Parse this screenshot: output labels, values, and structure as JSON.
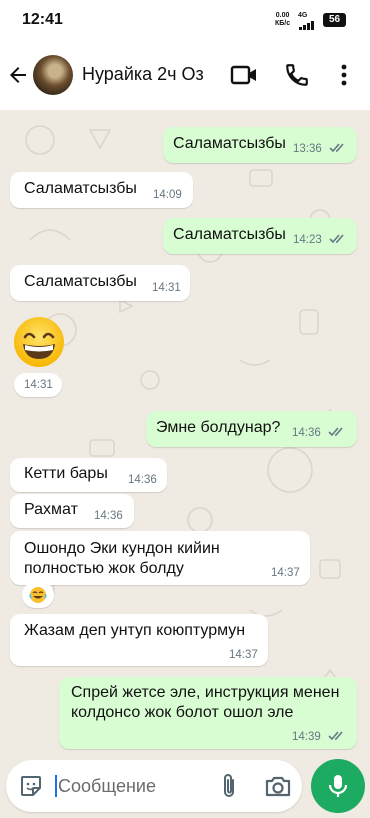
{
  "status_bar": {
    "time": "12:41",
    "net_speed": "0.00",
    "net_unit": "КБ/с",
    "network": "4G",
    "battery": "56"
  },
  "header": {
    "contact_name": "Нурайка 2ч Оз",
    "icons": [
      "back-arrow-icon",
      "video-call-icon",
      "phone-icon",
      "more-vert-icon"
    ]
  },
  "messages": [
    {
      "dir": "out",
      "text": "Саламатсызбы",
      "time": "13:36",
      "read": true
    },
    {
      "dir": "in",
      "text": "Саламатсызбы",
      "time": "14:09"
    },
    {
      "dir": "out",
      "text": "Саламатсызбы",
      "time": "14:23",
      "read": true
    },
    {
      "dir": "in",
      "text": "Саламатсызбы",
      "time": "14:31"
    },
    {
      "dir": "in",
      "emoji": "grinning-face",
      "time": "14:31"
    },
    {
      "dir": "out",
      "text": "Эмне болдунар?",
      "time": "14:36",
      "read": true
    },
    {
      "dir": "in",
      "text": "Кетти бары",
      "time": "14:36"
    },
    {
      "dir": "in",
      "text": "Рахмат",
      "time": "14:36"
    },
    {
      "dir": "in",
      "text": "Ошондо Эки кундон кийин полностью жок болду",
      "time": "14:37"
    },
    {
      "dir": "in",
      "reaction": "tears-of-joy"
    },
    {
      "dir": "in",
      "text": "Жазам деп унтуп коюптурмун",
      "time": "14:37"
    },
    {
      "dir": "out",
      "text": "Спрей жетсе эле, инструкция менен колдонсо жок болот ошол эле",
      "time": "14:39",
      "read": true
    }
  ],
  "composer": {
    "placeholder": "Сообщение",
    "value": ""
  },
  "colors": {
    "outgoing_bubble": "#d9fdd3",
    "incoming_bubble": "#ffffff",
    "chat_background": "#efeae2",
    "mic_button": "#1daa61",
    "read_tick": "#53bdeb"
  }
}
